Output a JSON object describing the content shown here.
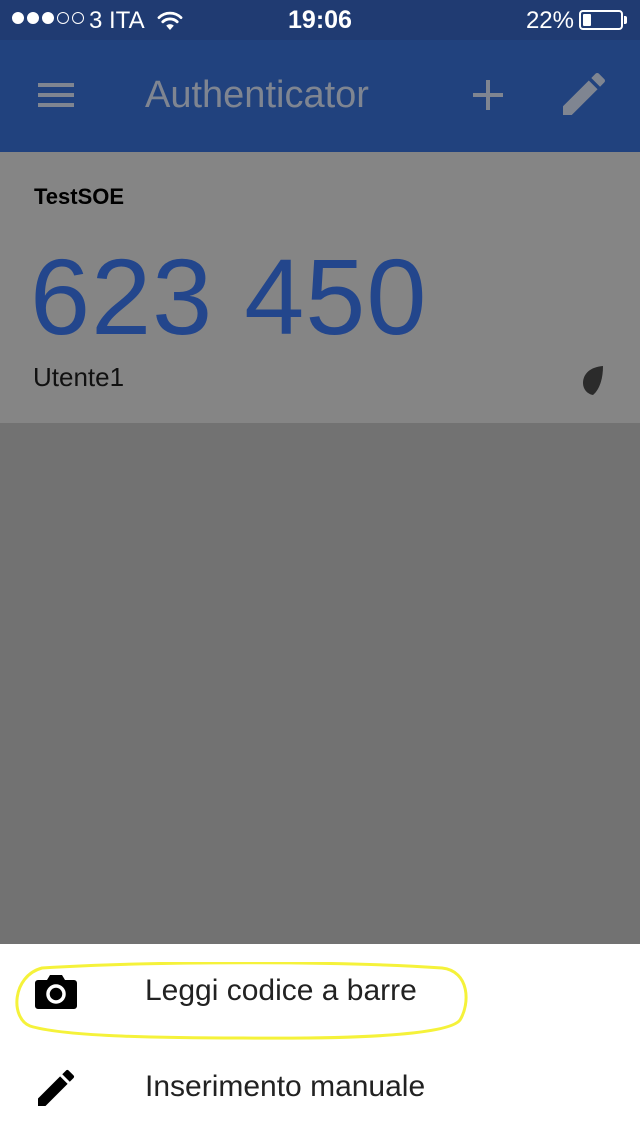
{
  "status_bar": {
    "signal_dots_filled": 3,
    "signal_dots_total": 5,
    "carrier": "3 ITA",
    "time": "19:06",
    "battery_percent": "22%",
    "battery_level": 0.22,
    "icons": [
      "wifi-icon",
      "battery-icon"
    ]
  },
  "app_bar": {
    "title": "Authenticator",
    "icons": [
      "menu-icon",
      "add-icon",
      "edit-icon"
    ]
  },
  "account_card": {
    "issuer": "TestSOE",
    "code": "623 450",
    "account_name": "Utente1",
    "timer_icon": "countdown-timer-icon"
  },
  "bottom_sheet": {
    "items": [
      {
        "label": "Leggi codice a barre",
        "icon": "camera-icon"
      },
      {
        "label": "Inserimento manuale",
        "icon": "pencil-icon"
      }
    ]
  },
  "colors": {
    "status_bar": "#203b72",
    "app_bar": "#21427e",
    "code": "#23468c",
    "scrim": "#727272",
    "highlight": "#f5f23a"
  }
}
